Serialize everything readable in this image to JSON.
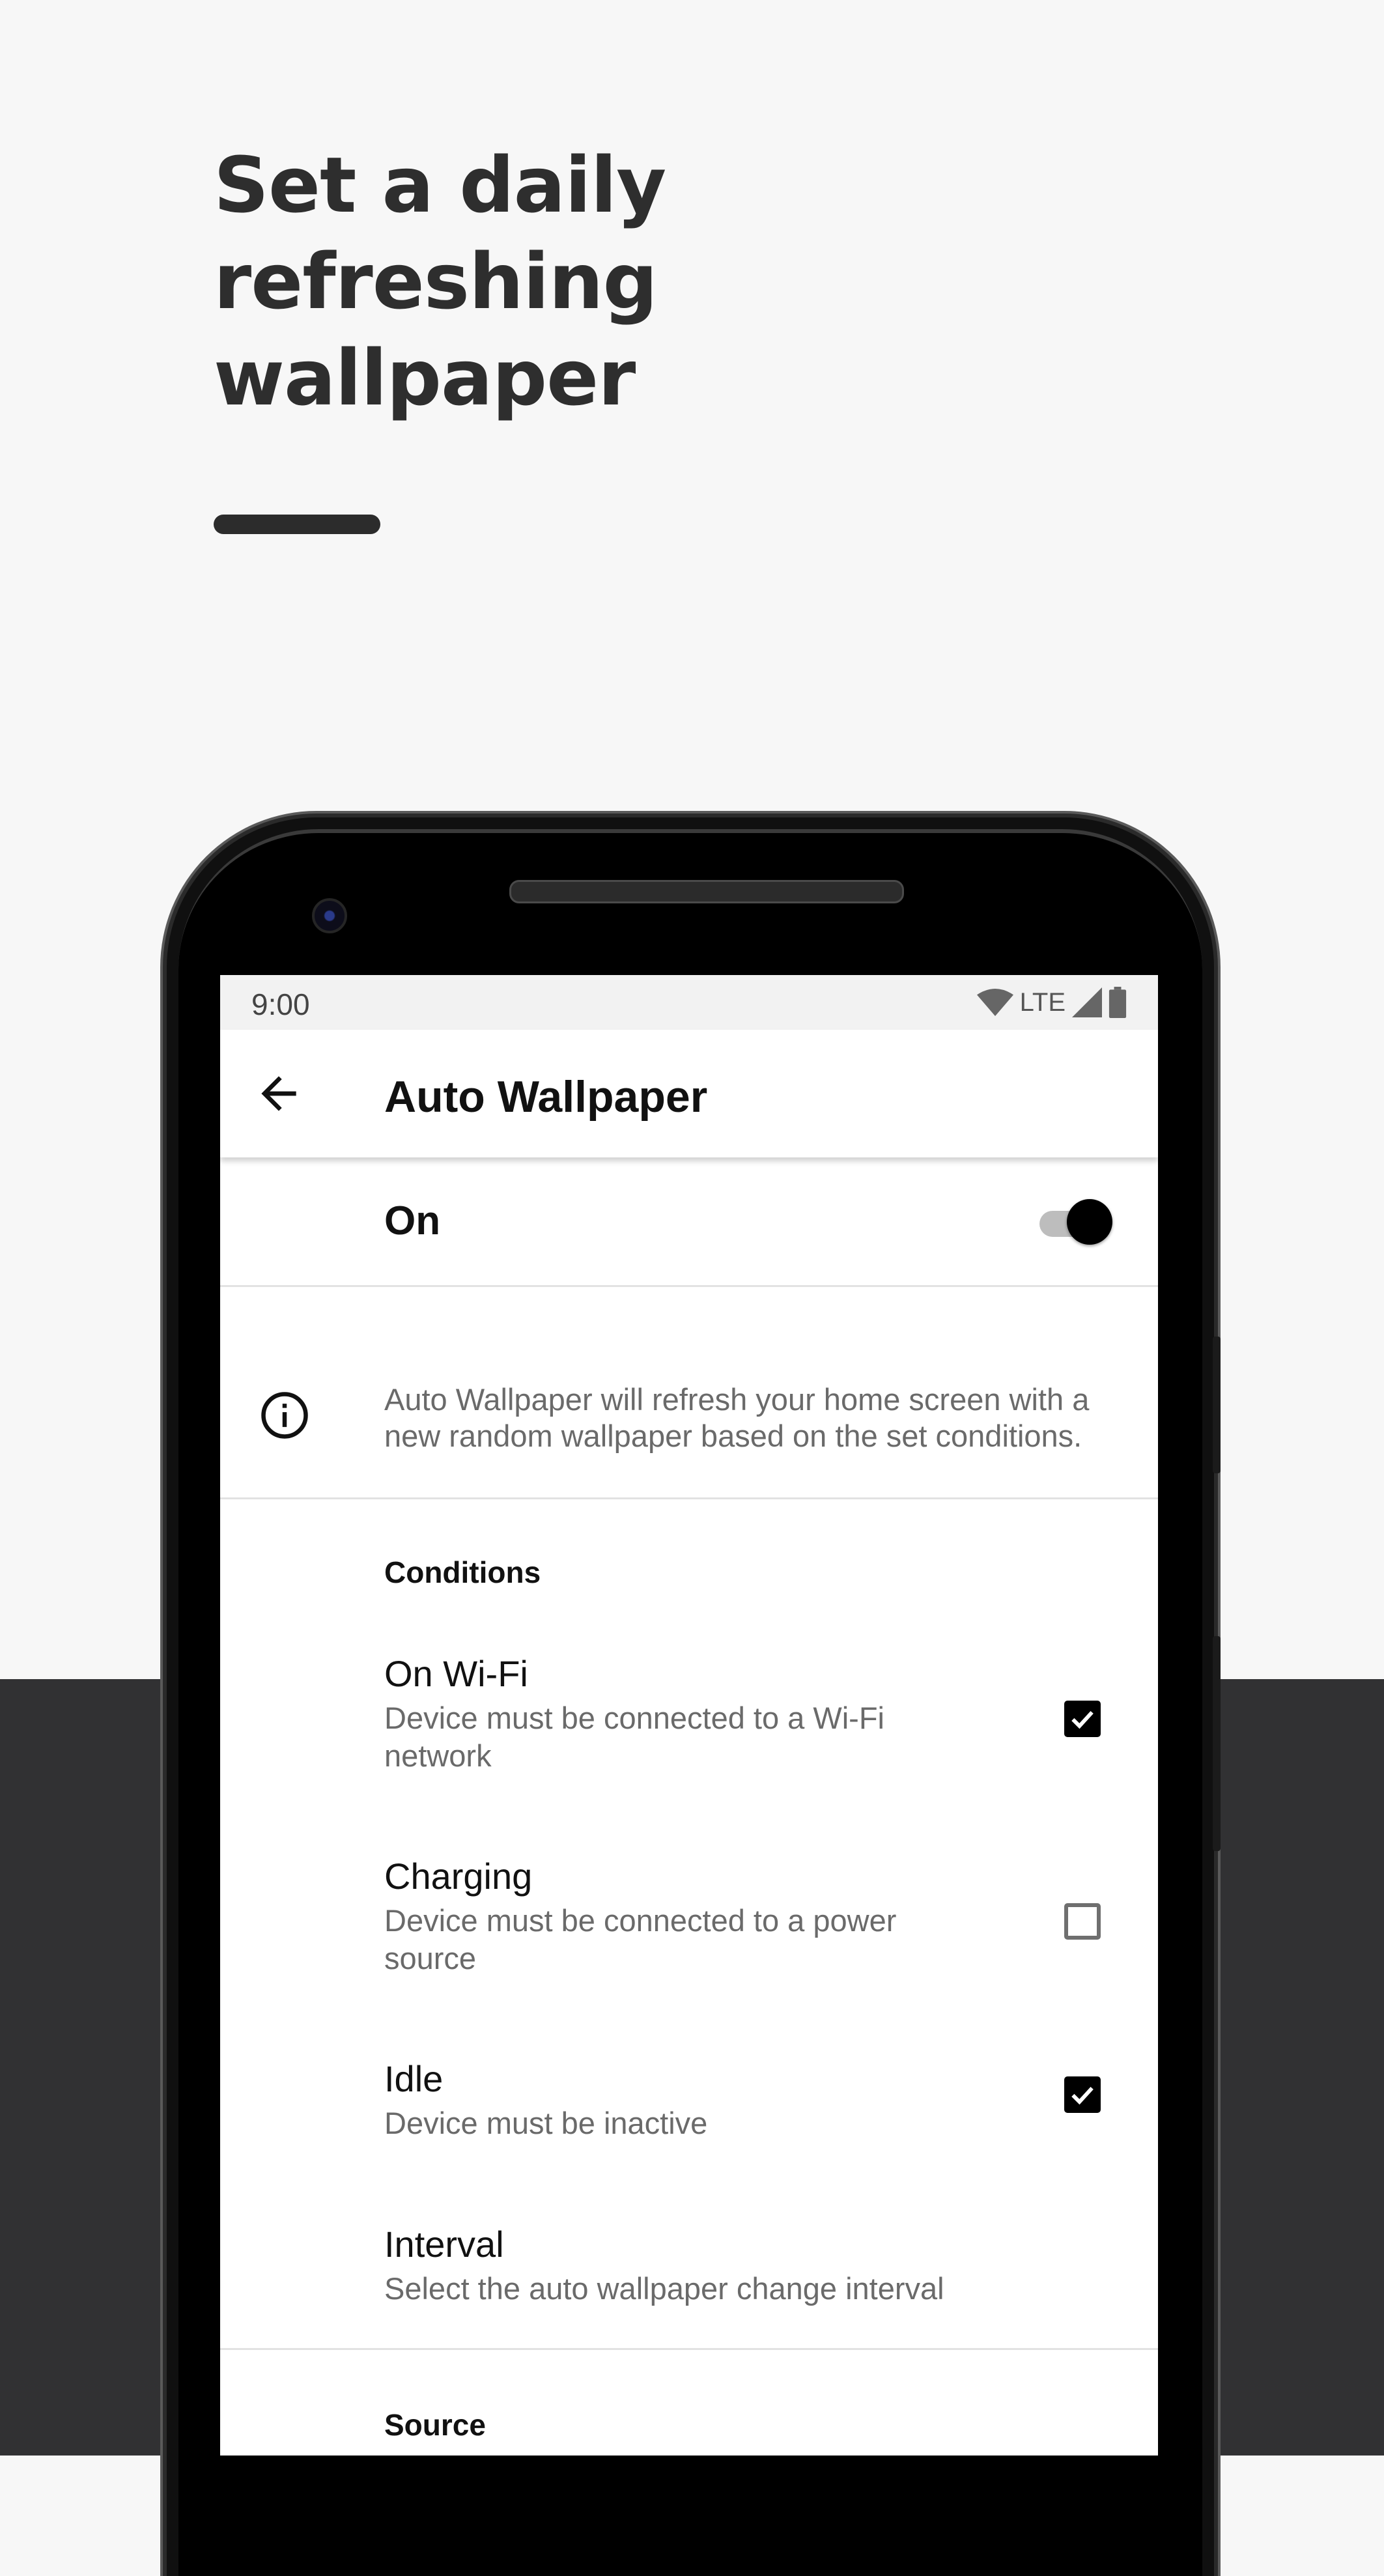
{
  "promo": {
    "headline_lines": [
      "Set a daily",
      "refreshing",
      "wallpaper"
    ]
  },
  "status_bar": {
    "time": "9:00",
    "network": "LTE"
  },
  "app_bar": {
    "title": "Auto Wallpaper",
    "back_icon": "arrow-back-icon"
  },
  "master_switch": {
    "label": "On",
    "enabled": true
  },
  "info": {
    "icon": "info-icon",
    "text": "Auto Wallpaper will refresh your home screen with a new random wallpaper based on the set conditions."
  },
  "conditions": {
    "section_title": "Conditions",
    "items": [
      {
        "title": "On Wi-Fi",
        "summary": "Device must be connected to a Wi-Fi network",
        "checked": true
      },
      {
        "title": "Charging",
        "summary": "Device must be connected to a power source",
        "checked": false
      },
      {
        "title": "Idle",
        "summary": "Device must be inactive",
        "checked": true
      },
      {
        "title": "Interval",
        "summary": "Select the auto wallpaper change interval"
      }
    ]
  },
  "source": {
    "section_title": "Source"
  },
  "colors": {
    "accent": "#000000",
    "switch_track": "#bdbdbd",
    "secondary_text": "#6a6a6a",
    "background_light": "#f7f7f7",
    "background_dark": "#313133"
  }
}
